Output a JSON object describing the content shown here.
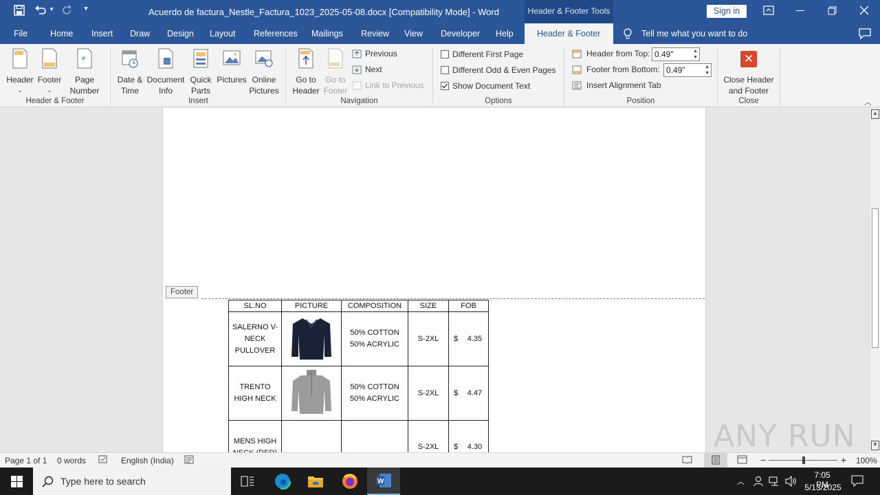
{
  "window": {
    "title": "Acuerdo de factura_Nestle_Factura_1023_2025-05-08.docx [Compatibility Mode]  -  Word",
    "contextual_tools": "Header & Footer Tools",
    "sign_in": "Sign in"
  },
  "tabs": [
    "File",
    "Home",
    "Insert",
    "Draw",
    "Design",
    "Layout",
    "References",
    "Mailings",
    "Review",
    "View",
    "Developer",
    "Help",
    "Header & Footer"
  ],
  "tell_me": "Tell me what you want to do",
  "ribbon": {
    "header_footer": {
      "header": "Header",
      "footer": "Footer",
      "page_number": "Page Number",
      "label": "Header & Footer"
    },
    "insert": {
      "date_time": "Date & Time",
      "doc_info": "Document Info",
      "quick_parts": "Quick Parts",
      "pictures": "Pictures",
      "online_pictures": "Online Pictures",
      "label": "Insert"
    },
    "navigation": {
      "go_header": "Go to Header",
      "go_footer": "Go to Footer",
      "previous": "Previous",
      "next": "Next",
      "link_previous": "Link to Previous",
      "label": "Navigation"
    },
    "options": {
      "diff_first": "Different First Page",
      "diff_odd_even": "Different Odd & Even Pages",
      "show_doc_text": "Show Document Text",
      "label": "Options"
    },
    "position": {
      "header_from_top": "Header from Top:",
      "header_value": "0.49\"",
      "footer_from_bottom": "Footer from Bottom:",
      "footer_value": "0.49\"",
      "insert_align": "Insert Alignment Tab",
      "label": "Position"
    },
    "close": {
      "close_btn": "Close Header and Footer",
      "label": "Close"
    }
  },
  "document": {
    "footer_tag": "Footer",
    "table": {
      "headers": [
        "SL.NO",
        "PICTURE",
        "COMPOSITION",
        "SIZE",
        "FOB"
      ],
      "rows": [
        {
          "name": "SALERNO V-NECK PULLOVER",
          "composition": "50% COTTON 50% ACRYLIC",
          "size": "S-2XL",
          "currency": "$",
          "price": "4.35"
        },
        {
          "name": "TRENTO HIGH NECK",
          "composition": "50% COTTON 50% ACRYLIC",
          "size": "S-2XL",
          "currency": "$",
          "price": "4.47"
        },
        {
          "name": "MENS HIGH NECK (RED)",
          "composition": "",
          "size": "S-2XL",
          "currency": "$",
          "price": "4.30"
        }
      ]
    }
  },
  "status": {
    "page": "Page 1 of 1",
    "words": "0 words",
    "language": "English (India)",
    "zoom": "100%"
  },
  "taskbar": {
    "search_placeholder": "Type here to search",
    "time": "7:05 PM",
    "date": "5/13/2025"
  },
  "watermark": "ANY RUN",
  "colors": {
    "word_blue": "#2b579a",
    "close_red": "#d9452e",
    "taskbar": "#1b1b1b"
  }
}
